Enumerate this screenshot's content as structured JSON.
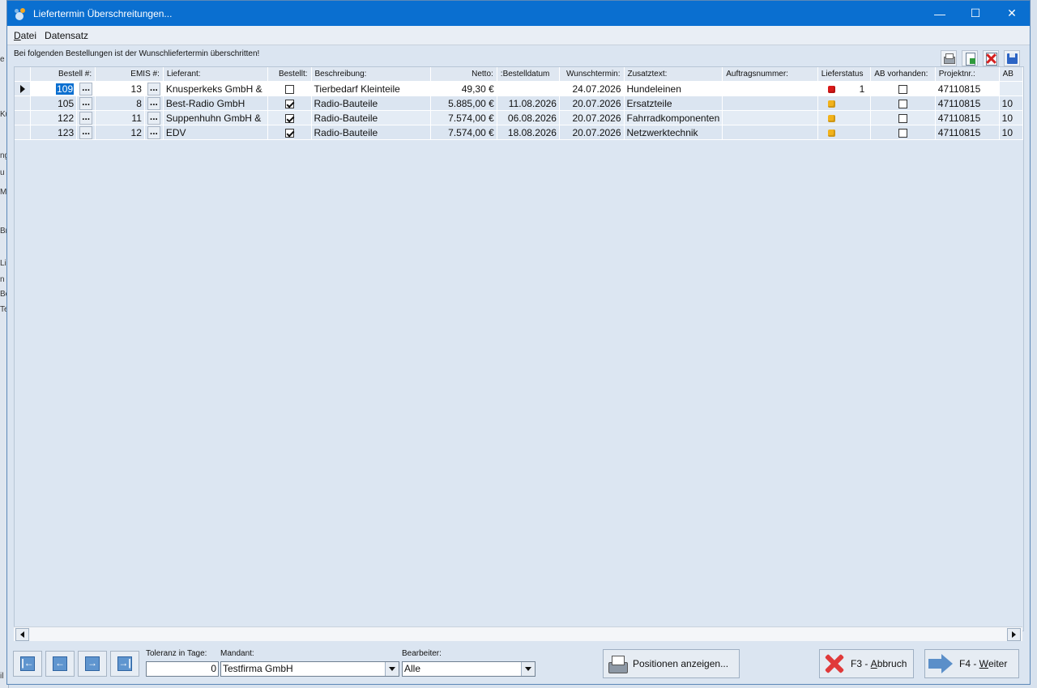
{
  "background_fragments": [
    "e",
    "Ku",
    "ng",
    "u",
    "Mi",
    "Br",
    "Lie",
    "n",
    "Be",
    "Te",
    "il"
  ],
  "window": {
    "title": "Liefertermin Überschreitungen...",
    "controls": {
      "minimize": "—",
      "maximize": "☐",
      "close": "✕"
    }
  },
  "menu": [
    {
      "label": "Datei",
      "accel": "D",
      "rest": "atei"
    },
    {
      "label": "Datensatz",
      "accel": "",
      "rest": "Datensatz"
    }
  ],
  "info_text": "Bei folgenden Bestellungen ist der Wunschliefertermin überschritten!",
  "toolbar_icons": [
    "printer-icon",
    "export-excel-icon",
    "delete-icon",
    "save-icon"
  ],
  "columns": {
    "bestell_nr": "Bestell #:",
    "emis_nr": "EMIS #:",
    "lieferant": "Lieferant:",
    "bestellt": "Bestellt:",
    "beschreibung": "Beschreibung:",
    "netto": "Netto:",
    "bestelldatum": "Bestelldatum:",
    "wunschtermin": "Wunschtermin:",
    "zusatztext": "Zusatztext:",
    "auftragsnummer": "Auftragsnummer:",
    "lieferstatus": "Lieferstatus",
    "ab_vorhanden": "AB vorhanden:",
    "projektnr": "Projektnr.:",
    "ab": "AB"
  },
  "rows": [
    {
      "bestell_nr": "109",
      "emis_nr": "13",
      "lieferant": "Knusperkeks GmbH &",
      "bestellt": false,
      "beschreibung": "Tierbedarf Kleinteile",
      "netto": "49,30 €",
      "bestelldatum": "",
      "wunschtermin": "24.07.2026",
      "zusatztext": "Hundeleinen",
      "auftragsnummer": "",
      "status_color": "#d81818",
      "status_count": "1",
      "ab_vorhanden": false,
      "projektnr": "47110815",
      "ab": ""
    },
    {
      "bestell_nr": "105",
      "emis_nr": "8",
      "lieferant": "Best-Radio GmbH",
      "bestellt": true,
      "beschreibung": "Radio-Bauteile",
      "netto": "5.885,00 €",
      "bestelldatum": "11.08.2026",
      "wunschtermin": "20.07.2026",
      "zusatztext": "Ersatzteile",
      "auftragsnummer": "",
      "status_color": "#f2b21a",
      "status_count": "",
      "ab_vorhanden": false,
      "projektnr": "47110815",
      "ab": "10"
    },
    {
      "bestell_nr": "122",
      "emis_nr": "11",
      "lieferant": "Suppenhuhn GmbH &",
      "bestellt": true,
      "beschreibung": "Radio-Bauteile",
      "netto": "7.574,00 €",
      "bestelldatum": "06.08.2026",
      "wunschtermin": "20.07.2026",
      "zusatztext": "Fahrradkomponenten",
      "auftragsnummer": "",
      "status_color": "#f2b21a",
      "status_count": "",
      "ab_vorhanden": false,
      "projektnr": "47110815",
      "ab": "10"
    },
    {
      "bestell_nr": "123",
      "emis_nr": "12",
      "lieferant": "EDV",
      "bestellt": true,
      "beschreibung": "Radio-Bauteile",
      "netto": "7.574,00 €",
      "bestelldatum": "18.08.2026",
      "wunschtermin": "20.07.2026",
      "zusatztext": "Netzwerktechnik",
      "auftragsnummer": "",
      "status_color": "#f2b21a",
      "status_count": "",
      "ab_vorhanden": false,
      "projektnr": "47110815",
      "ab": "10"
    }
  ],
  "dropdown_glyph": "...",
  "footer": {
    "toleranz_label": "Toleranz in Tage:",
    "toleranz_value": "0",
    "mandant_label": "Mandant:",
    "mandant_value": "Testfirma GmbH",
    "bearbeiter_label": "Bearbeiter:",
    "bearbeiter_value": "Alle",
    "positionen_button": "Positionen anzeigen...",
    "abbruch_prefix": "F3 - ",
    "abbruch_accel": "A",
    "abbruch_rest": "bbruch",
    "weiter_prefix": "F4 - ",
    "weiter_accel": "W",
    "weiter_rest": "eiter",
    "nav": {
      "first": "|←",
      "prev": "←",
      "next": "→",
      "last": "→|"
    }
  }
}
